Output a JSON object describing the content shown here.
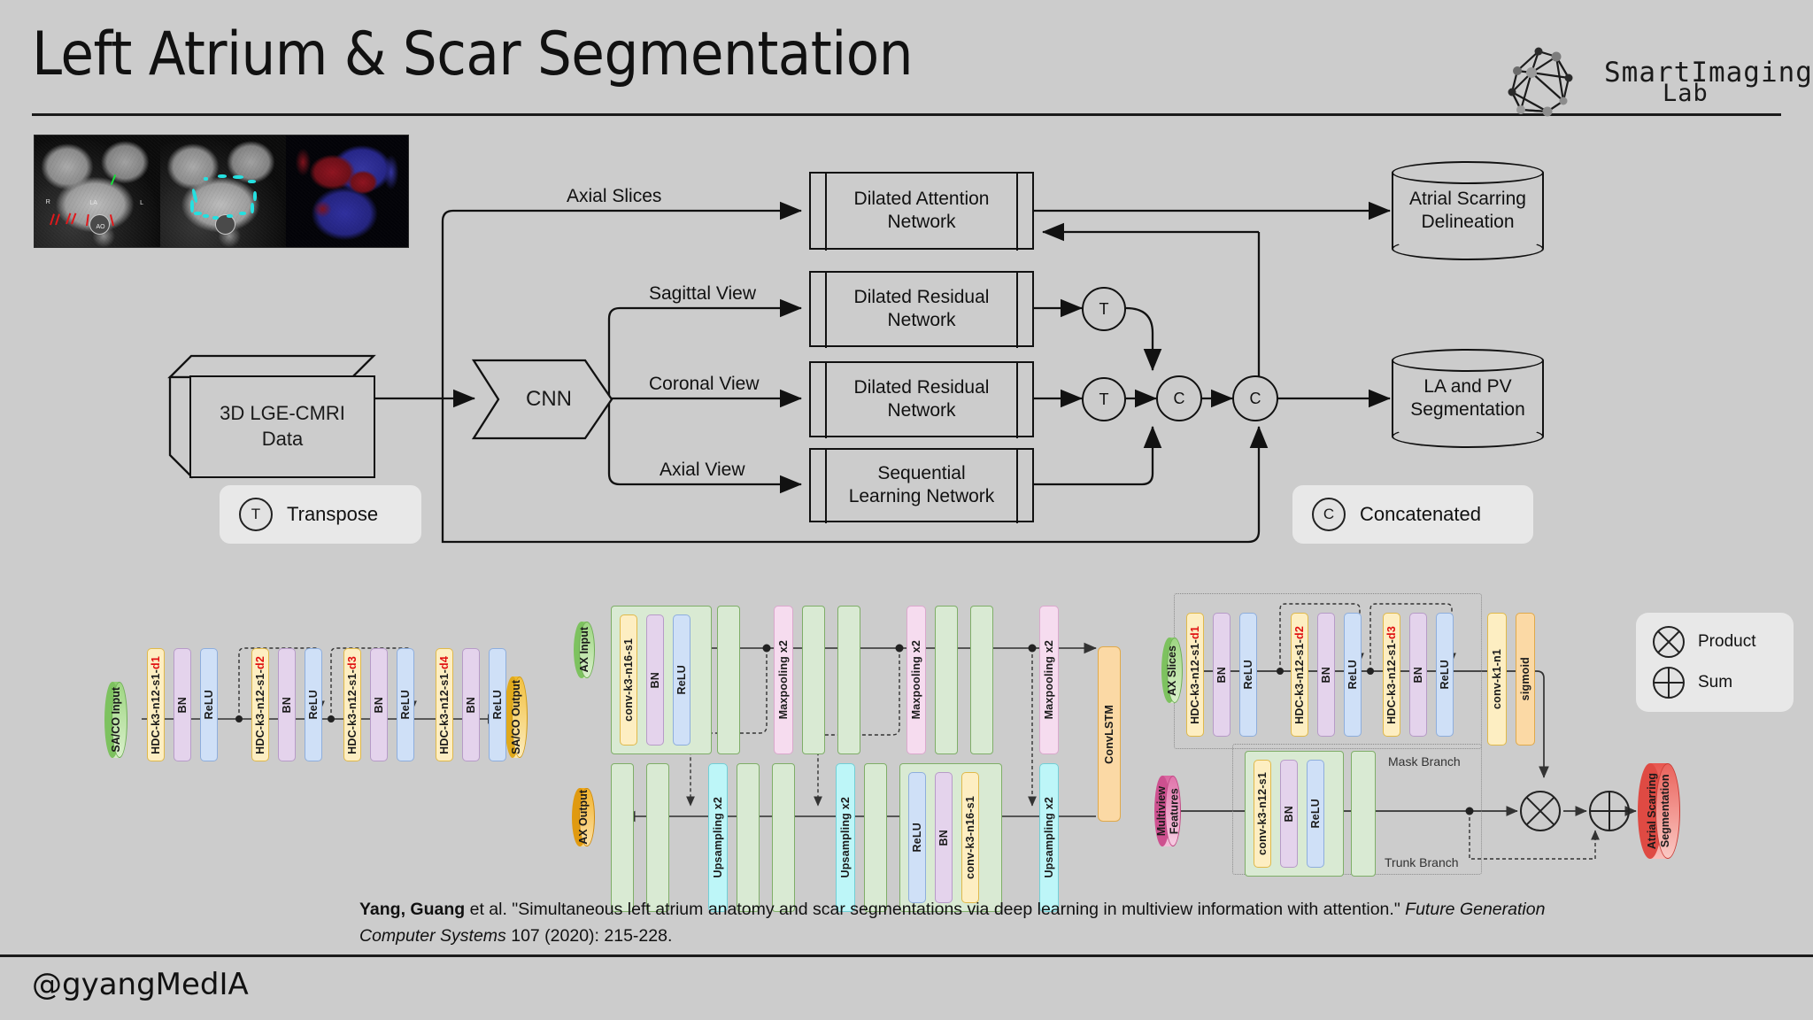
{
  "header": {
    "title": "Left Atrium & Scar Segmentation",
    "logo": {
      "smart": "SmartImaging",
      "lab": "Lab",
      "graph_icon": "network-graph-icon"
    }
  },
  "footer": {
    "handle": "@gyangMedIA"
  },
  "thumbnail": {
    "name": "lge-cmri-example-images",
    "panes": [
      "raw-axial-lge-cmri",
      "segmented-axial-lge-cmri",
      "3d-scar-rendering"
    ],
    "annotations": [
      "LA",
      "R",
      "L",
      "AO"
    ]
  },
  "flowchart": {
    "input_cube": "3D LGE-CMRI\nData",
    "input_cube_line1": "3D LGE-CMRI",
    "input_cube_line2": "Data",
    "cnn": "CNN",
    "edge_labels": {
      "axial_slices": "Axial Slices",
      "sagittal_view": "Sagittal View",
      "coronal_view": "Coronal View",
      "axial_view": "Axial View"
    },
    "boxes": [
      {
        "id": "dilated-attention-network",
        "line1": "Dilated Attention",
        "line2": "Network"
      },
      {
        "id": "dilated-residual-network-sagittal",
        "line1": "Dilated Residual",
        "line2": "Network"
      },
      {
        "id": "dilated-residual-network-coronal",
        "line1": "Dilated Residual",
        "line2": "Network"
      },
      {
        "id": "sequential-learning-network",
        "line1": "Sequential",
        "line2": "Learning Network"
      }
    ],
    "outputs": [
      {
        "id": "atrial-scarring-delineation",
        "line1": "Atrial Scarring",
        "line2": "Delineation"
      },
      {
        "id": "la-and-pv-segmentation",
        "line1": "LA and PV",
        "line2": "Segmentation"
      }
    ],
    "ops": {
      "transpose_symbol": "T",
      "concat_symbol": "C"
    },
    "legend": [
      {
        "symbol": "T",
        "label": "Transpose"
      },
      {
        "symbol": "C",
        "label": "Concatenated"
      }
    ]
  },
  "diagram_left": {
    "name": "sa-co-dilated-residual-network",
    "input": "SA/CO Input",
    "output": "SA/CO Output",
    "blocks": [
      {
        "label": "HDC-k3-n12-s1-",
        "accent": "d1",
        "color": "#fdeec2"
      },
      {
        "label": "BN",
        "color": "#e4d3ec"
      },
      {
        "label": "ReLU",
        "color": "#cfe0f7"
      },
      {
        "label": "HDC-k3-n12-s1-",
        "accent": "d2",
        "color": "#fdeec2"
      },
      {
        "label": "BN",
        "color": "#e4d3ec"
      },
      {
        "label": "ReLU",
        "color": "#cfe0f7"
      },
      {
        "label": "HDC-k3-n12-s1-",
        "accent": "d3",
        "color": "#fdeec2"
      },
      {
        "label": "BN",
        "color": "#e4d3ec"
      },
      {
        "label": "ReLU",
        "color": "#cfe0f7"
      },
      {
        "label": "HDC-k3-n12-s1-",
        "accent": "d4",
        "color": "#fdeec2"
      },
      {
        "label": "BN",
        "color": "#e4d3ec"
      },
      {
        "label": "ReLU",
        "color": "#cfe0f7"
      }
    ]
  },
  "diagram_middle": {
    "name": "axial-sequential-learning-unet",
    "input": "AX Input",
    "output": "AX Output",
    "encoder": [
      {
        "label": "conv-k3-n16-s1",
        "color": "#fdeec2"
      },
      {
        "label": "BN",
        "color": "#e4d3ec"
      },
      {
        "label": "ReLU",
        "color": "#cfe0f7"
      },
      {
        "label": "Maxpooling x2",
        "color": "#f6dcef"
      },
      {
        "label": "Maxpooling x2",
        "color": "#f6dcef"
      },
      {
        "label": "Maxpooling x2",
        "color": "#f6dcef"
      }
    ],
    "decoder": [
      {
        "label": "Upsampling x2",
        "color": "#bdf6f8"
      },
      {
        "label": "Upsampling x2",
        "color": "#bdf6f8"
      },
      {
        "label": "ReLU",
        "color": "#cfe0f7"
      },
      {
        "label": "BN",
        "color": "#e4d3ec"
      },
      {
        "label": "conv-k3-n16-s1",
        "color": "#fdeec2"
      },
      {
        "label": "Upsampling x2",
        "color": "#bdf6f8"
      }
    ],
    "bottleneck": {
      "label": "ConvLSTM",
      "color": "#fbd9a5"
    }
  },
  "diagram_right": {
    "name": "attention-mask-trunk-branch",
    "input_mask": "AX Slices",
    "input_trunk": "Multiview\nFeatures",
    "input_trunk_line1": "Multiview",
    "input_trunk_line2": "Features",
    "output": "Atrial Scarring\nSegmentation",
    "output_line1": "Atrial Scarring",
    "output_line2": "Segmentation",
    "mask_branch_label": "Mask Branch",
    "trunk_branch_label": "Trunk Branch",
    "mask_blocks": [
      {
        "label": "HDC-k3-n12-s1-",
        "accent": "d1",
        "color": "#fdeec2"
      },
      {
        "label": "BN",
        "color": "#e4d3ec"
      },
      {
        "label": "ReLU",
        "color": "#cfe0f7"
      },
      {
        "label": "HDC-k3-n12-s1-",
        "accent": "d2",
        "color": "#fdeec2"
      },
      {
        "label": "BN",
        "color": "#e4d3ec"
      },
      {
        "label": "ReLU",
        "color": "#cfe0f7"
      },
      {
        "label": "HDC-k3-n12-s1-",
        "accent": "d3",
        "color": "#fdeec2"
      },
      {
        "label": "BN",
        "color": "#e4d3ec"
      },
      {
        "label": "ReLU",
        "color": "#cfe0f7"
      },
      {
        "label": "conv-k1-n1",
        "color": "#fdeec2"
      },
      {
        "label": "sigmoid",
        "color": "#fbd9a5"
      }
    ],
    "trunk_blocks": [
      {
        "label": "conv-k3-n12-s1",
        "color": "#fdeec2"
      },
      {
        "label": "BN",
        "color": "#e4d3ec"
      },
      {
        "label": "ReLU",
        "color": "#cfe0f7"
      }
    ],
    "legend": [
      {
        "symbol": "product-icon",
        "label": "Product"
      },
      {
        "symbol": "sum-icon",
        "label": "Sum"
      }
    ]
  },
  "citation": {
    "authors": "Yang, Guang",
    "middle": " et al. \"Simultaneous left atrium anatomy and scar segmentations via deep learning in multiview information with attention.\" ",
    "journal": "Future Generation Computer Systems",
    "tail": " 107 (2020): 215-228."
  },
  "colors": {
    "background": "#cccccc",
    "ink": "#111111",
    "accent_red": "#e01010",
    "green_input": "#a8d98a",
    "yellow_output": "#f4b731",
    "pink_input": "#e08ab8",
    "red_output": "#e8726e",
    "unet_green": "#d9ead3"
  }
}
